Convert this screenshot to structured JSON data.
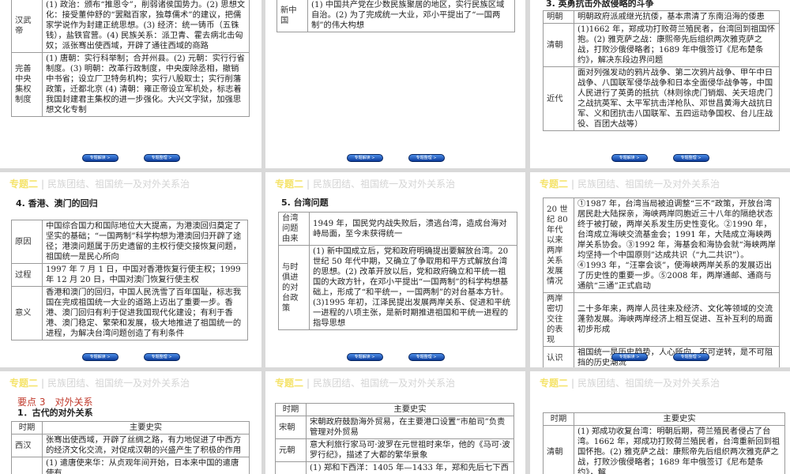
{
  "header": {
    "key": "专题二",
    "title": "民族团结、祖国统一及对外关系治"
  },
  "nav": {
    "prev": "专题解读 >",
    "next": "专题整理 >"
  },
  "slides": [
    {
      "title": "",
      "rows": [
        [
          "汉武帝",
          "(1) 政治：颁布“推恩令”，削弱诸侯国势力。(2) 思想文化：接受董仲舒的“罢黜百家，独尊儒术”的建议，把儒家学说作为封建正统思想。(3) 经济：统一铸币（五铢钱），盐铁官营。(4) 民族关系：派卫青、霍去病北击匈奴；派张骞出使西域，开辟了通往西域的商路"
        ],
        [
          "完善中央集权制度",
          "(1) 唐朝：实行科举制；合并州县。(2) 元朝：实行行省制度。(3) 明朝：改革行政制度，中央废除丞相，撤销中书省；设立厂卫特务机构；实行八股取士；实行削藩政策，迁都北京 (4) 清朝：雍正帝设立军机处，标志着我国封建君主集权的进一步强化。大兴文字狱，加强思想文化专制"
        ]
      ]
    },
    {
      "title": "",
      "rows": [
        [
          "新中国",
          "(1) 中国共产党在少数民族聚居的地区，实行民族区域自治。(2) 为了完成统一大业，邓小平提出了“一国两制”的伟大构想"
        ]
      ]
    },
    {
      "title": "3. 英勇抗击外敌侵略的斗争",
      "rows": [
        [
          "明朝",
          "明朝政府派戚继光抗倭，基本肃清了东南沿海的倭患"
        ],
        [
          "清朝",
          "(1)1662 年，郑成功打败荷兰殖民者，台湾回到祖国怀抱。(2) 雅克萨之战：康熙帝先后组织两次雅克萨之战，打败沙俄侵略者；1689 年中俄签订《尼布楚条约》，解决东段边界问题"
        ],
        [
          "近代",
          "面对列强发动的鸦片战争、第二次鸦片战争、甲午中日战争、八国联军侵华战争和日本全面侵华战争等，中国人民进行了英勇的抵抗（林则徐虎门销烟、关天培虎门之战抗英军、太平军抗击洋枪队、邓世昌黄海大战抗日军、义和团抗击八国联军、五四运动争国权、台儿庄战役、百团大战等）"
        ]
      ]
    },
    {
      "title": "4. 香港、澳门的回归",
      "rows": [
        [
          "原因",
          "中国综合国力和国际地位大大提高，为港澳回归奠定了坚实的基础；“一国两制”科学构想为港澳回归开辟了途径；港澳问题属于历史遗留的主权行使交接恢复问题，祖国统一是民心所向"
        ],
        [
          "过程",
          "1997 年 7 月 1 日，中国对香港恢复行使主权；1999 年 12 月 20 日，中国对澳门恢复行使主权"
        ],
        [
          "意义",
          "香港和澳门的回归，中国人民洗雪了百年国耻，标志我国在完成祖国统一大业的道路上迈出了重要一步。香港、澳门回归有利于促进我国现代化建设；有利于香港、澳门稳定、繁荣和发展，极大地推进了祖国统一的进程，为解决台湾问题创造了有利条件"
        ]
      ]
    },
    {
      "title": "5. 台湾问题",
      "rows": [
        [
          "台湾问题由来",
          "1949 年，国民党内战失败后，溃逃台湾，造成台海对峙局面，至今未获得统一"
        ],
        [
          "与时俱进的对台政策",
          "(1) 新中国成立后，党和政府明确提出要解放台湾。20 世纪 50 年代中期，又确立了争取用和平方式解放台湾的思想。(2) 改革开放以后，党和政府确立和平统一祖国的大政方针，在邓小平提出“一国两制”的科学构想基础上，形成了“和平统一，一国两制”的对台基本方针。(3)1995 年初，江泽民提出发展两岸关系、促进和平统一进程的八项主张，是新时期推进祖国和平统一进程的指导思想"
        ]
      ]
    },
    {
      "title": "",
      "rows": [
        [
          "20 世纪 80 年代以来两岸关系发展情况",
          "①1987 年，台湾当局被迫调整“三不”政策，开放台湾居民赴大陆探亲，海峡两岸同胞近三十八年的隔绝状态终于被打破，两岸关系发生历史性变化。②1990 年，台湾成立海峡交流基金会；1991 年，大陆成立海峡两岸关系协会。③1992 年，海基会和海协会就“海峡两岸均坚持一个中国原则”达成共识（“九二共识”）。④1993 年，“汪辜会谈”，使海峡两岸关系的发展迈出了历史性的重要一步。⑤2008 年，两岸通邮、通商与通航“三通”正式启动"
        ],
        [
          "两岸密切交往的表现",
          "二十多年来，两岸人员往来及经济、文化等领域的交流蓬勃发展。海峡两岸经济上相互促进、互补互利的局面初步形成"
        ],
        [
          "认识",
          "祖国统一是历史趋势，人心所向，不可逆转，是不可阻挡的历史潮流"
        ]
      ]
    },
    {
      "section": "要点 3　对外关系",
      "title": "1．古代的对外关系",
      "rows": [
        [
          "时期",
          "主要史实"
        ],
        [
          "西汉",
          "张骞出使西域，开辟了丝绸之路，有力地促进了中西方的经济文化交流，对促成汉朝的兴盛产生了积极的作用"
        ],
        [
          "",
          "(1) 遣唐使来华：从贞观年间开始，日本来中国的遣唐使有"
        ]
      ]
    },
    {
      "title": "",
      "rows": [
        [
          "时期",
          "主要史实"
        ],
        [
          "宋朝",
          "宋朝政府鼓励海外贸易，在主要港口设置“市舶司”负责管理对外贸易"
        ],
        [
          "元朝",
          "意大利旅行家马可·波罗在元世祖时来华，他的《马可·波罗行纪》，描述了大都的繁华景象"
        ],
        [
          "",
          "(1) 郑和下西洋：1405 年—1433 年，郑和先后七下西"
        ]
      ]
    },
    {
      "title": "",
      "rows": [
        [
          "时期",
          "主要史实"
        ],
        [
          "清朝",
          "(1) 郑成功收复台湾：明朝后期，荷兰殖民者侵占了台湾。1662 年，郑成功打败荷兰殖民者，台湾重新回到祖国怀抱。(2) 雅克萨之战：康熙帝先后组织两次雅克萨之战，打败沙俄侵略者；1689 年中俄签订《尼布楚条约》，解"
        ]
      ]
    }
  ]
}
